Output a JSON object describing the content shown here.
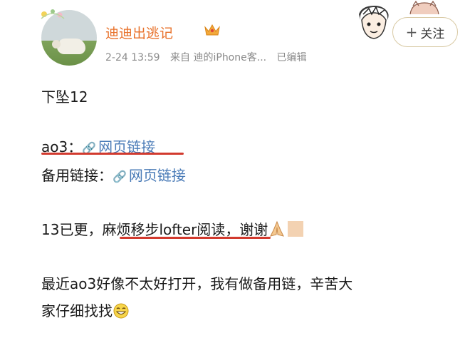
{
  "post": {
    "author": "迪迪出逃记",
    "date": "2-24 13:59",
    "source": "来自 迪的iPhone客...",
    "edited": "已编辑",
    "follow_label": "关注"
  },
  "body": {
    "line1": "下坠12",
    "ao3_label": "ao3：",
    "ao3_link": "网页链接",
    "backup_label": "备用链接：",
    "backup_link": "网页链接",
    "update_prefix": "13已更，",
    "update_highlight": "麻烦移步lofter阅读",
    "update_suffix": "，谢谢",
    "note_line1": "最近ao3好像不太好打开，我有做备用链，辛苦大",
    "note_line2": "家仔细找找"
  },
  "colors": {
    "username": "#e8712a",
    "link": "#4a7bb7",
    "underline": "#d23a2e",
    "meta": "#8a8a8a"
  },
  "icons": [
    "crown-icon",
    "link-chain-icon",
    "pray-emoji-icon",
    "smile-emoji-icon",
    "cartoon-boy-sticker",
    "avatar-photo"
  ]
}
